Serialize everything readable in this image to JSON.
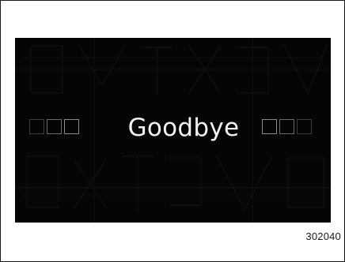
{
  "screen": {
    "message": "Goodbye",
    "background_color": "#050505",
    "text_color": "#f2f2f2"
  },
  "figure": {
    "code": "302040"
  }
}
